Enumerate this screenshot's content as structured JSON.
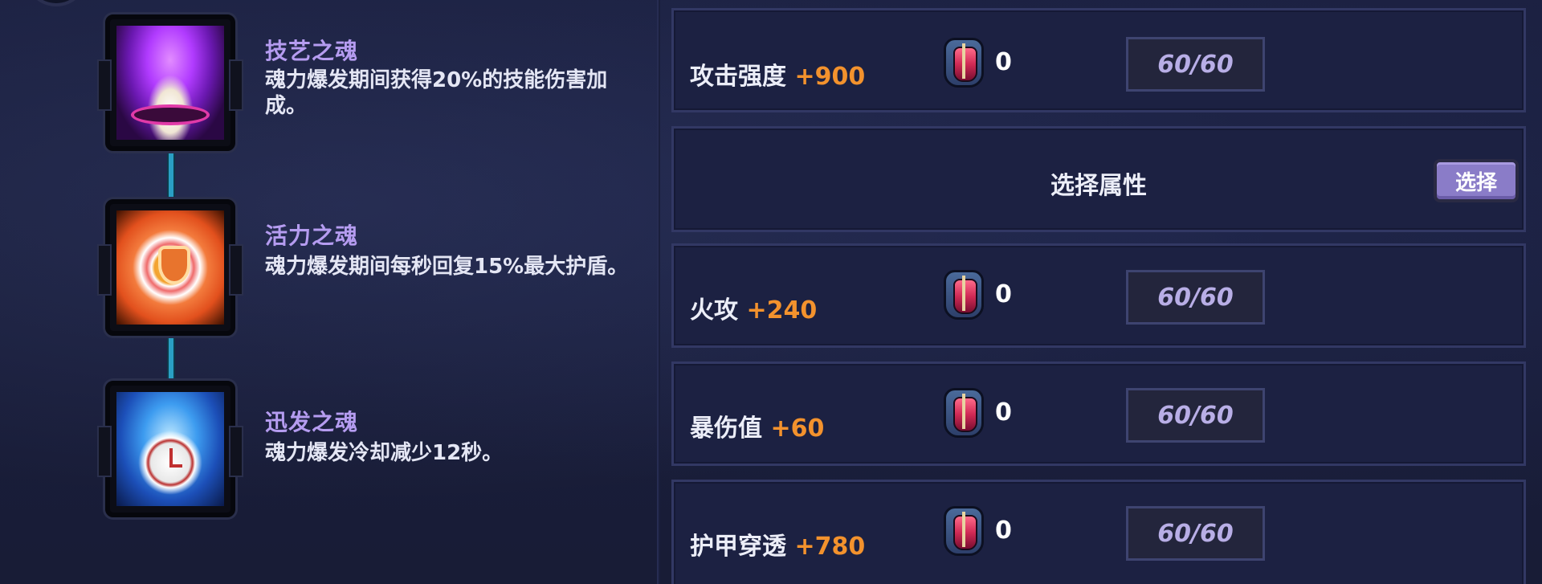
{
  "skills": [
    {
      "title": "技艺之魂",
      "desc": "魂力爆发期间获得20%的技能伤害加成。",
      "icon": "purple-flame-book-icon"
    },
    {
      "title": "活力之魂",
      "desc": "魂力爆发期间每秒回复15%最大护盾。",
      "icon": "orange-shield-icon"
    },
    {
      "title": "迅发之魂",
      "desc": "魂力爆发冷却减少12秒。",
      "icon": "blue-clock-icon"
    }
  ],
  "attributes": {
    "row1": {
      "label": "攻击强度",
      "bonus": "+900",
      "gem_count": "0",
      "progress": "60/60"
    },
    "select": {
      "label": "选择属性",
      "button": "选择"
    },
    "row3": {
      "label": "火攻",
      "bonus": "+240",
      "gem_count": "0",
      "progress": "60/60"
    },
    "row4": {
      "label": "暴伤值",
      "bonus": "+60",
      "gem_count": "0",
      "progress": "60/60"
    },
    "row5": {
      "label": "护甲穿透",
      "bonus": "+780",
      "gem_count": "0",
      "progress": "60/60"
    }
  },
  "colors": {
    "bonus": "#f3922d",
    "skill_title": "#b59cf0",
    "button": "#8a7cc8",
    "background": "#1a1e3a"
  }
}
